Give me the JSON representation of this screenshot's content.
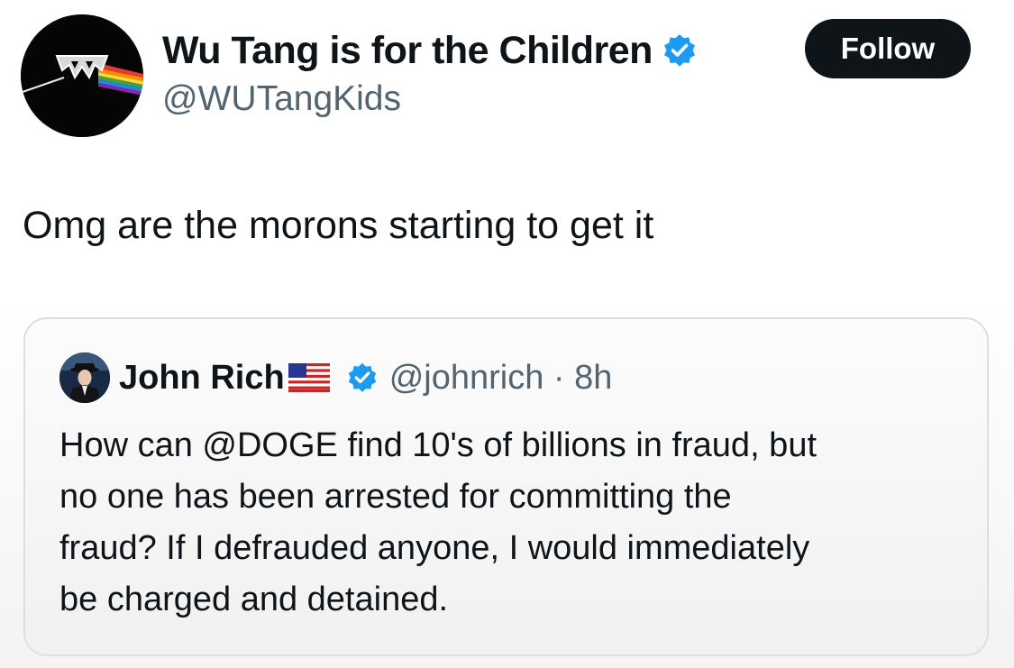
{
  "tweet": {
    "author_name": "Wu Tang is for the Children",
    "author_handle": "@WUTangKids",
    "follow_label": "Follow",
    "text": "Omg are the morons starting to get it"
  },
  "quote": {
    "author_name": "John Rich",
    "handle_time": "@johnrich · 8h",
    "text_lines": [
      "How can @DOGE find 10's of billions in fraud, but",
      "no one has been arrested for committing the",
      "fraud? If I defrauded anyone, I would immediately",
      "be charged and detained."
    ]
  },
  "icons": {
    "verified": "verified-badge-icon",
    "flag": "us-flag-icon"
  },
  "colors": {
    "verified_blue": "#1d9bf0",
    "follow_bg": "#0f1419",
    "secondary_text": "#536471"
  }
}
